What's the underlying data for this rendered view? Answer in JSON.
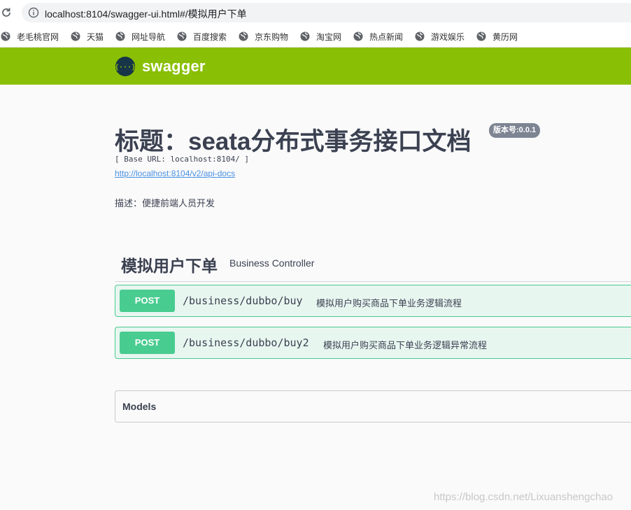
{
  "browser": {
    "url": "localhost:8104/swagger-ui.html#/模拟用户下单",
    "bookmarks": [
      {
        "label": "老毛桃官网"
      },
      {
        "label": "天猫"
      },
      {
        "label": "网址导航"
      },
      {
        "label": "百度搜索"
      },
      {
        "label": "京东购物"
      },
      {
        "label": "淘宝网"
      },
      {
        "label": "热点新闻"
      },
      {
        "label": "游戏娱乐"
      },
      {
        "label": "黄历网"
      }
    ]
  },
  "topbar": {
    "logo_text": "swagger",
    "logo_glyph": "{···}"
  },
  "info": {
    "title": "标题：seata分布式事务接口文档",
    "version": "版本号:0.0.1",
    "base_url": "[ Base URL: localhost:8104/ ]",
    "api_docs_link": "http://localhost:8104/v2/api-docs",
    "description": "描述：便捷前端人员开发"
  },
  "tag": {
    "name": "模拟用户下单",
    "description": "Business Controller"
  },
  "operations": [
    {
      "method": "POST",
      "path": "/business/dubbo/buy",
      "summary": "模拟用户购买商品下单业务逻辑流程"
    },
    {
      "method": "POST",
      "path": "/business/dubbo/buy2",
      "summary": "模拟用户购买商品下单业务逻辑异常流程"
    }
  ],
  "models": {
    "label": "Models"
  },
  "watermark": "https://blog.csdn.net/Lixuanshengchao",
  "colors": {
    "topbar": "#89bf04",
    "post": "#49cc90",
    "post_bg": "#e8f6f0",
    "badge": "#7d8492",
    "link": "#4990e2"
  }
}
